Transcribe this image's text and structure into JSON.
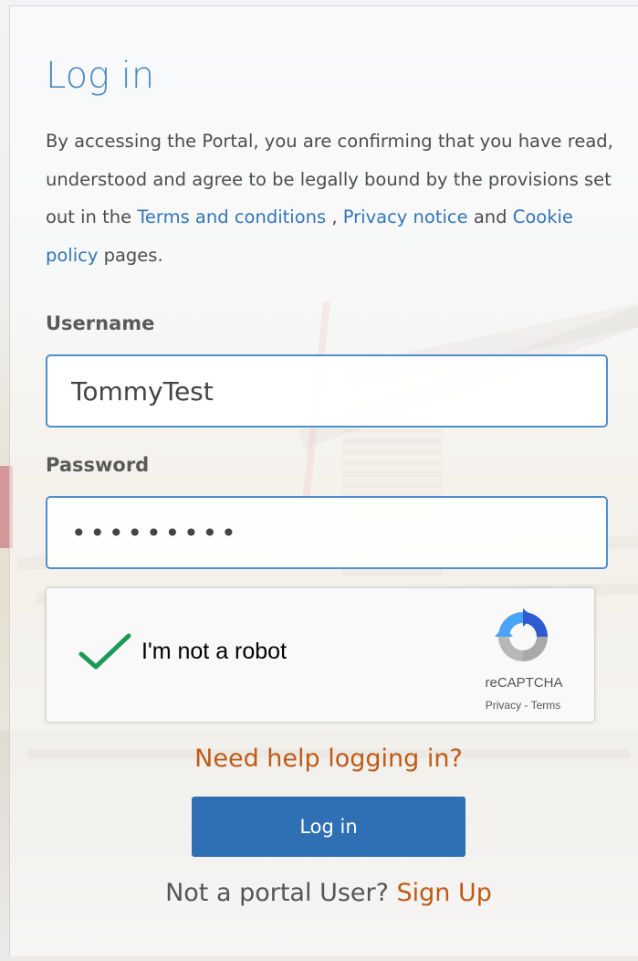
{
  "form": {
    "title": "Log in",
    "intro": {
      "text_before": "By accessing the Portal, you are confirming that you have read, understood and agree to be legally bound by the provisions set out in the ",
      "terms_link": "Terms and conditions",
      "separator": " , ",
      "privacy_link": "Privacy notice",
      "text_and": " and ",
      "cookie_link": "Cookie policy",
      "text_after": " pages."
    },
    "username_label": "Username",
    "username_value": "TommyTest",
    "password_label": "Password",
    "password_value": "•••••••••",
    "help_link": "Need help logging in?",
    "login_button": "Log in",
    "signup_prompt": "Not a portal User? ",
    "signup_link": "Sign Up"
  },
  "captcha": {
    "label": "I'm not a robot",
    "brand": "reCAPTCHA",
    "privacy": "Privacy",
    "separator": " - ",
    "terms": "Terms",
    "checked": true
  },
  "colors": {
    "title": "#4a8ac4",
    "link": "#3176b8",
    "accent_orange": "#c05a18",
    "button": "#2f6fb4",
    "field_border": "#4f8fcd",
    "check_green": "#1a9a5a"
  },
  "icons": {
    "checkmark": "checkmark-icon",
    "recaptcha_logo": "recaptcha-logo-icon"
  }
}
